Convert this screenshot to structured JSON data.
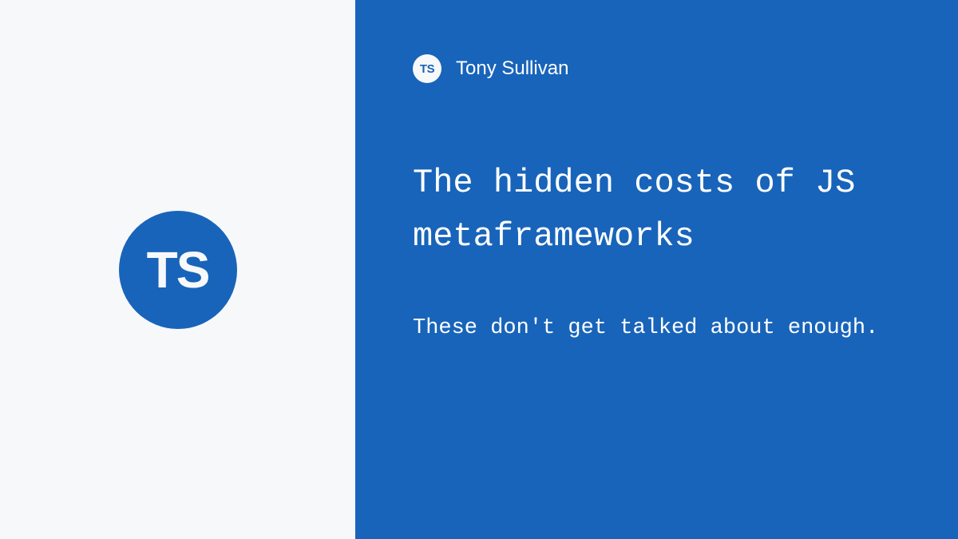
{
  "logo": {
    "initials": "TS"
  },
  "author": {
    "name": "Tony Sullivan"
  },
  "article": {
    "title": "The hidden costs of JS metaframeworks",
    "subtitle": "These don't get talked about enough."
  }
}
